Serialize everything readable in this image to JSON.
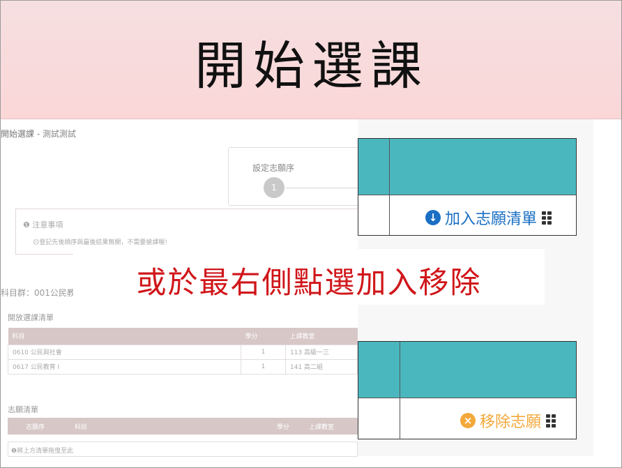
{
  "banner": {
    "title": "開始選課"
  },
  "page": {
    "breadcrumb_main": "開始選課",
    "breadcrumb_sub": " - 測試測試",
    "step_label": "設定志願序",
    "step_number": "1",
    "notice_title": "注意事項",
    "notice_text": "登記先後順序與最後結果無關，不需要搶課喔!",
    "subject_group": "科目群：001公民教",
    "open_list_title": "開放選課清單",
    "open_list_headers": [
      "科目",
      "學分",
      "上課教室"
    ],
    "open_list_rows": [
      [
        "0610 公民與社會",
        "1",
        "113 高級一三"
      ],
      [
        "0617 公民教育 I",
        "1",
        "141 高二組"
      ]
    ],
    "wish_list_title": "志願清單",
    "wish_list_headers": [
      "志願序",
      "科目",
      "學分",
      "上課教室"
    ],
    "wish_list_note": "將上方清單拖曳至此"
  },
  "zoom": {
    "add_label": "加入志願清單",
    "remove_label": "移除志願"
  },
  "callout": {
    "text": "或於最右側點選加入移除"
  },
  "colors": {
    "header_teal": "#4ab7bf",
    "add_blue": "#1a6fc4",
    "remove_orange": "#f3a83b",
    "callout_red": "#d0161a",
    "banner_pink": "#fbd7d8"
  },
  "icons": {
    "add": "arrow-down-circle-icon",
    "remove": "x-circle-icon",
    "drag": "drag-handle-icon"
  }
}
